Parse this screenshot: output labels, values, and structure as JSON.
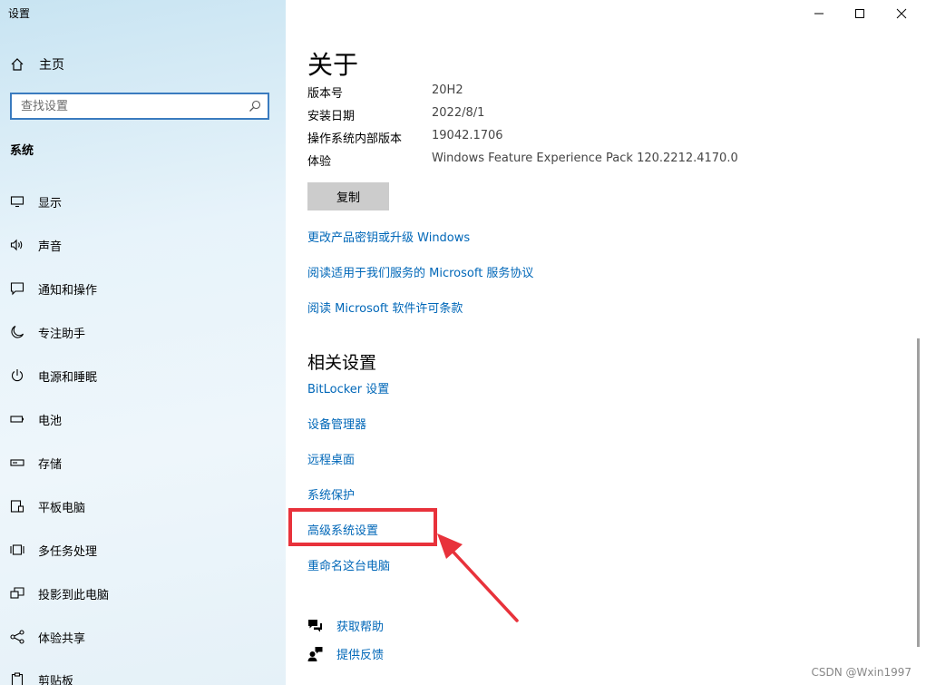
{
  "window": {
    "title": "设置"
  },
  "sidebar": {
    "home_label": "主页",
    "search_placeholder": "查找设置",
    "section_label": "系统",
    "items": [
      {
        "label": "显示",
        "icon": "monitor-icon"
      },
      {
        "label": "声音",
        "icon": "speaker-icon"
      },
      {
        "label": "通知和操作",
        "icon": "notification-icon"
      },
      {
        "label": "专注助手",
        "icon": "moon-icon"
      },
      {
        "label": "电源和睡眠",
        "icon": "power-icon"
      },
      {
        "label": "电池",
        "icon": "battery-icon"
      },
      {
        "label": "存储",
        "icon": "storage-icon"
      },
      {
        "label": "平板电脑",
        "icon": "tablet-icon"
      },
      {
        "label": "多任务处理",
        "icon": "multitask-icon"
      },
      {
        "label": "投影到此电脑",
        "icon": "project-icon"
      },
      {
        "label": "体验共享",
        "icon": "share-icon"
      },
      {
        "label": "剪贴板",
        "icon": "clipboard-icon"
      }
    ]
  },
  "about": {
    "title": "关于",
    "fields": [
      {
        "label": "版本号",
        "value": "20H2"
      },
      {
        "label": "安装日期",
        "value": "2022/8/1"
      },
      {
        "label": "操作系统内部版本",
        "value": "19042.1706"
      },
      {
        "label": "体验",
        "value": "Windows Feature Experience Pack 120.2212.4170.0"
      }
    ],
    "copy_label": "复制",
    "links": [
      "更改产品密钥或升级 Windows",
      "阅读适用于我们服务的 Microsoft 服务协议",
      "阅读 Microsoft 软件许可条款"
    ]
  },
  "related": {
    "title": "相关设置",
    "links": [
      "BitLocker 设置",
      "设备管理器",
      "远程桌面",
      "系统保护",
      "高级系统设置",
      "重命名这台电脑"
    ]
  },
  "help": {
    "get_help": "获取帮助",
    "feedback": "提供反馈"
  },
  "watermark": "CSDN @Wxin1997",
  "colors": {
    "link": "#0067b8",
    "annotation": "#e8323b",
    "accent": "#3a7bbf"
  }
}
